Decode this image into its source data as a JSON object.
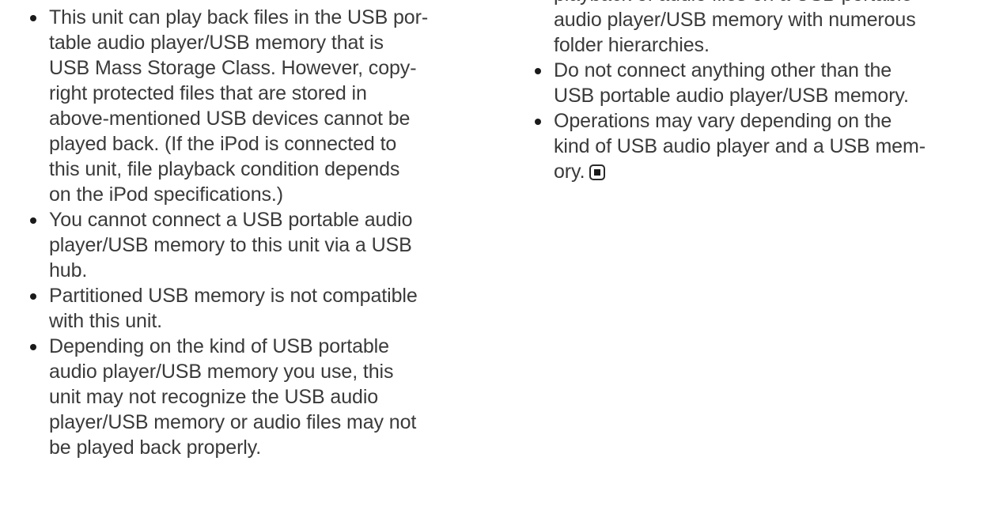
{
  "left_column": {
    "items": [
      {
        "lines": [
          "This unit can play back files in the USB por-",
          "table audio player/USB memory that is",
          "USB Mass Storage Class. However, copy-",
          "right protected files that are stored in",
          "above-mentioned USB devices cannot be",
          "played back. (If the iPod is connected to",
          "this unit, file playback condition depends",
          "on the iPod specifications.)"
        ]
      },
      {
        "lines": [
          "You cannot connect a USB portable audio",
          "player/USB memory to this unit via a USB",
          "hub."
        ]
      },
      {
        "lines": [
          "Partitioned USB memory is not compatible",
          "with this unit."
        ]
      },
      {
        "lines": [
          "Depending on the kind of USB portable",
          "audio player/USB memory you use, this",
          "unit may not recognize the USB audio",
          "player/USB memory or audio files may not",
          "be played back properly."
        ]
      }
    ]
  },
  "right_column": {
    "continued_lines": [
      "playback of audio files on a USB portable",
      "audio player/USB memory with numerous",
      "folder hierarchies."
    ],
    "items": [
      {
        "lines": [
          "Do not connect anything other than the",
          "USB portable audio player/USB memory."
        ]
      },
      {
        "lines": [
          "Operations may vary depending on the",
          "kind of USB audio player and a USB mem-",
          "ory."
        ]
      }
    ]
  },
  "end_mark_icon": "end-of-section-square-icon",
  "colors": {
    "text": "#3a3a3a",
    "bullet": "#1a1a1a",
    "background": "#ffffff"
  }
}
